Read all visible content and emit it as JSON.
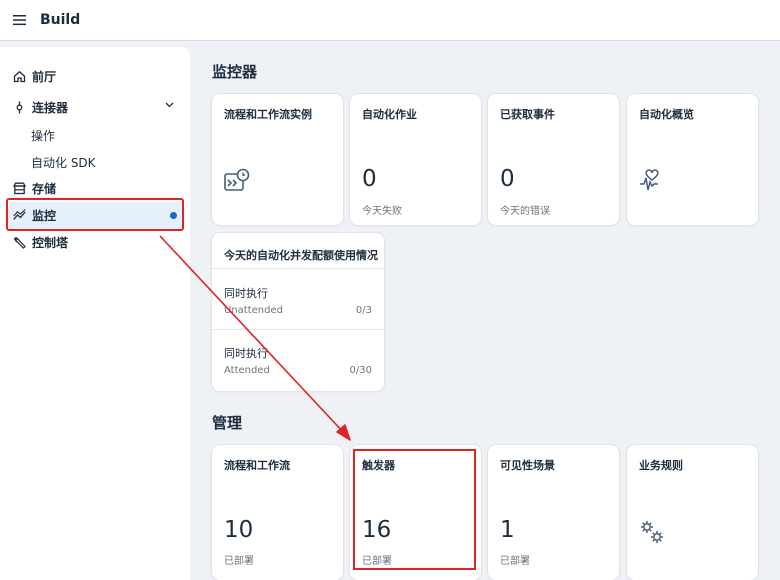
{
  "header": {
    "title": "Build"
  },
  "sidebar": {
    "items": [
      {
        "label": "前厅",
        "icon": "home-icon"
      },
      {
        "label": "连接器",
        "icon": "connector-icon"
      },
      {
        "label": "存储",
        "icon": "storage-icon"
      },
      {
        "label": "监控",
        "icon": "monitor-icon"
      },
      {
        "label": "控制塔",
        "icon": "wrench-icon"
      }
    ],
    "sub_items": [
      "操作",
      "自动化 SDK"
    ]
  },
  "monitor": {
    "title": "监控器",
    "cards": [
      {
        "title": "流程和工作流实例",
        "icon": "process-instance-icon"
      },
      {
        "title": "自动化作业",
        "value": "0",
        "sub": "今天失败"
      },
      {
        "title": "已获取事件",
        "value": "0",
        "sub": "今天的错误"
      },
      {
        "title": "自动化概览",
        "icon": "heart-pulse-icon"
      }
    ],
    "concurrency": {
      "title": "今天的自动化并发配额使用情况",
      "rows": [
        {
          "label": "同时执行",
          "sub": "Unattended",
          "count": "0/3"
        },
        {
          "label": "同时执行",
          "sub": "Attended",
          "count": "0/30"
        }
      ]
    }
  },
  "manage": {
    "title": "管理",
    "cards": [
      {
        "title": "流程和工作流",
        "value": "10",
        "sub": "已部署"
      },
      {
        "title": "触发器",
        "value": "16",
        "sub": "已部署"
      },
      {
        "title": "可见性场景",
        "value": "1",
        "sub": "已部署"
      },
      {
        "title": "业务规则",
        "icon": "gears-icon"
      }
    ]
  },
  "colors": {
    "accent": "#0a6ed1",
    "annotation": "#e02424"
  }
}
